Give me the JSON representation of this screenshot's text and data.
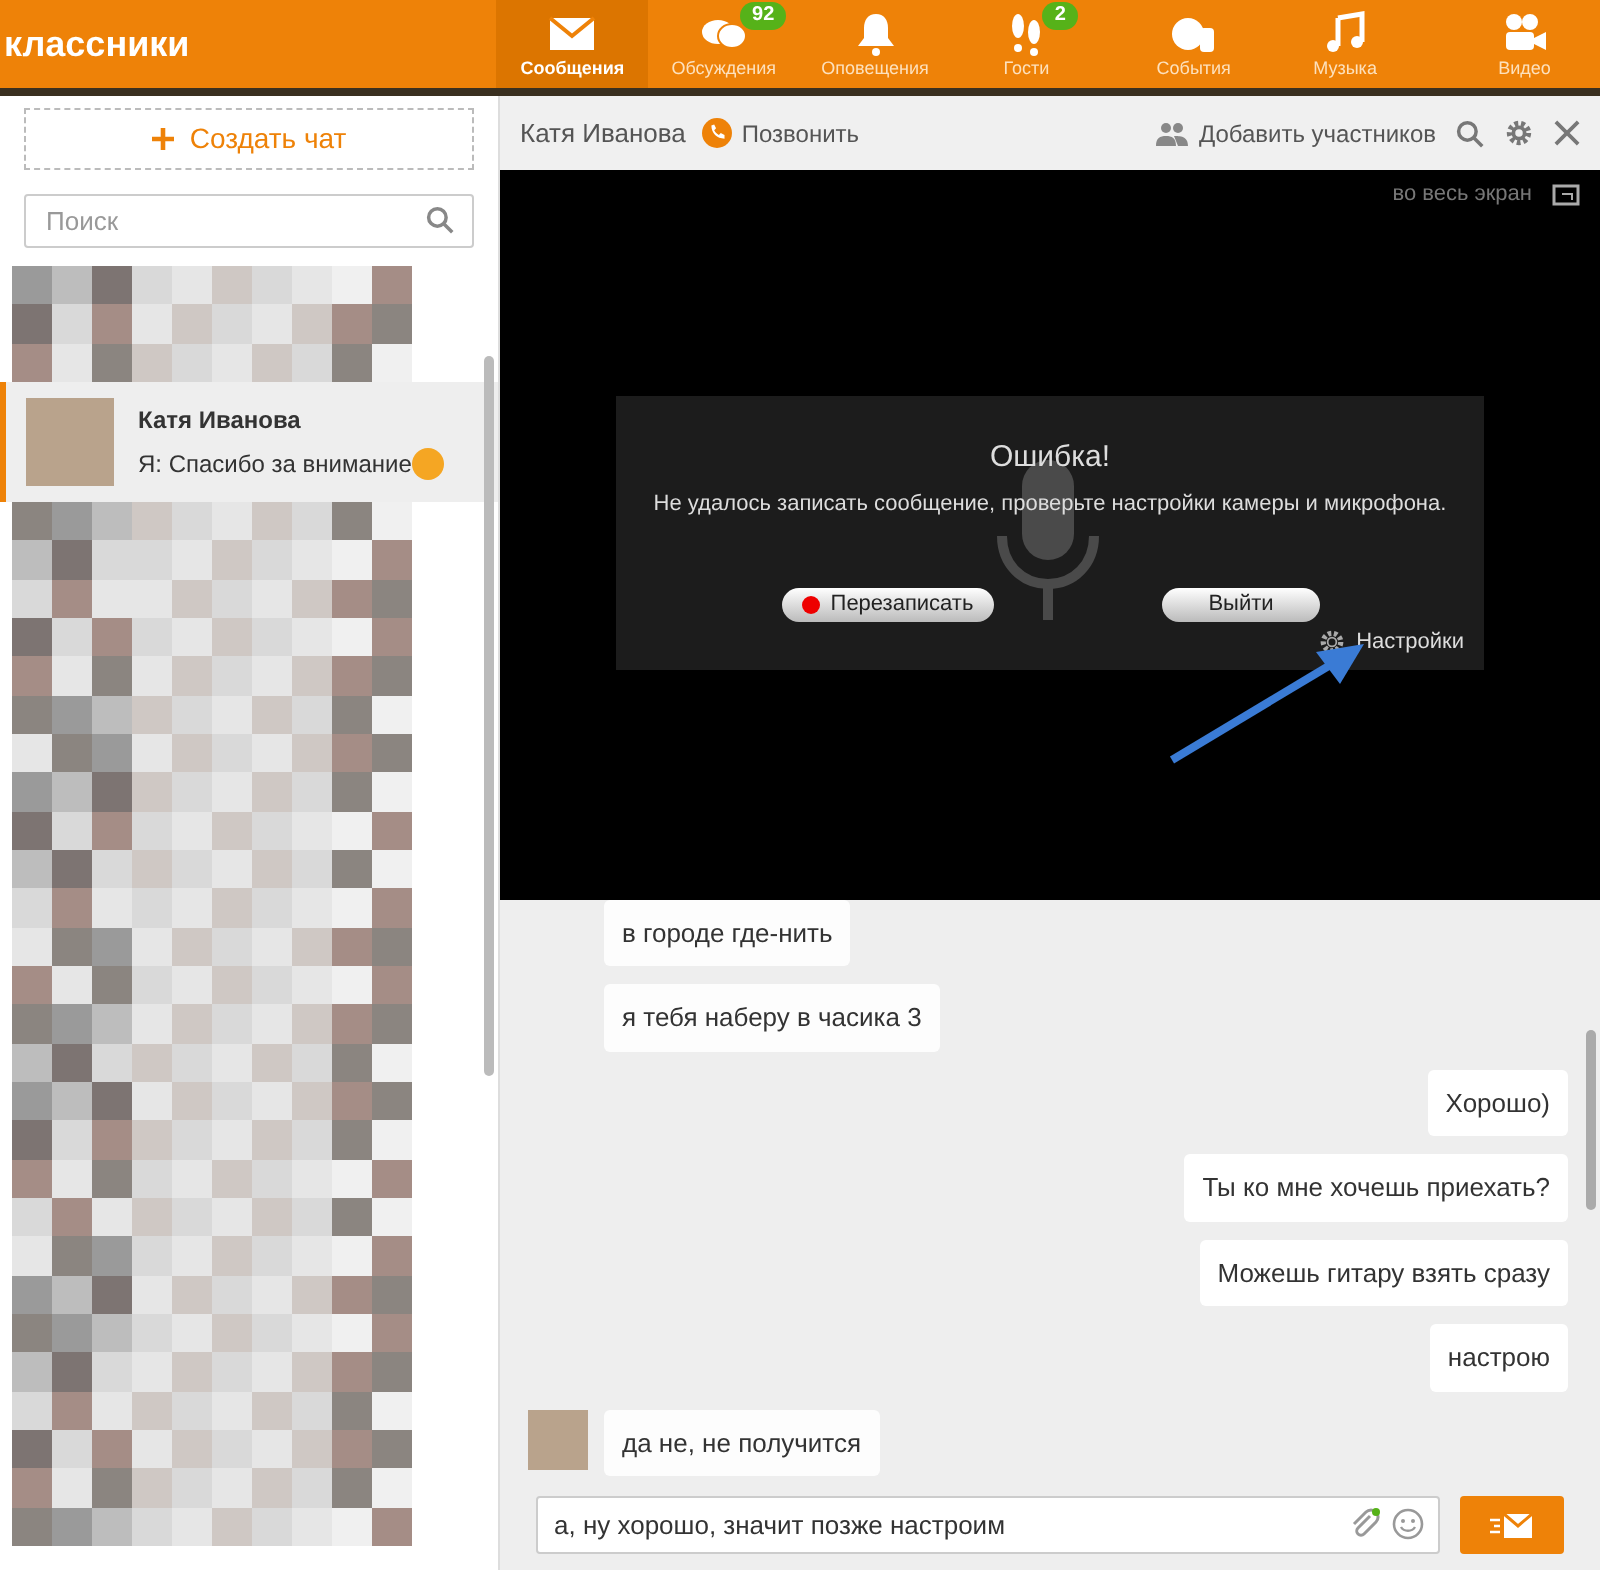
{
  "logo": {
    "text": "классники"
  },
  "nav": [
    {
      "kind": "mail",
      "label": "Сообщения",
      "selected": true
    },
    {
      "kind": "chat",
      "label": "Обсуждения",
      "badge": "92",
      "selected": false
    },
    {
      "kind": "bell",
      "label": "Оповещения",
      "selected": false
    },
    {
      "kind": "steps",
      "label": "Гости",
      "badge": "2",
      "selected": false
    },
    {
      "kind": "events",
      "label": "События",
      "selected": false
    },
    {
      "kind": "music",
      "label": "Музыка",
      "selected": false
    },
    {
      "kind": "video",
      "label": "Видео",
      "selected": false
    }
  ],
  "sidebar": {
    "create_chat": "Создать чат",
    "search": {
      "placeholder": "Поиск"
    },
    "contacts": [
      {
        "kind": "blurred",
        "selected": false
      },
      {
        "kind": "contact",
        "name": "Катя Иванова",
        "preview": "Я: Спасибо за внимание",
        "selected": true
      },
      {
        "kind": "blurred",
        "selected": false
      },
      {
        "kind": "blurred",
        "selected": false
      },
      {
        "kind": "blurred",
        "selected": false
      },
      {
        "kind": "blurred",
        "selected": false
      },
      {
        "kind": "blurred",
        "selected": false
      },
      {
        "kind": "blurred",
        "selected": false
      },
      {
        "kind": "blurred",
        "selected": false
      },
      {
        "kind": "blurred",
        "selected": false
      },
      {
        "kind": "blurred",
        "selected": false
      }
    ]
  },
  "chat": {
    "title": "Катя Иванова",
    "call": "Позвонить",
    "add_members": "Добавить участников"
  },
  "video": {
    "fullscreen": "во весь экран",
    "error_title": "Ошибка!",
    "error_text": "Не удалось записать сообщение, проверьте настройки камеры и микрофона.",
    "rerecord": "Перезаписать",
    "exit": "Выйти",
    "settings": "Настройки"
  },
  "messages": [
    {
      "kind": "incoming",
      "text": "в городе где-нить",
      "avatar": false
    },
    {
      "kind": "incoming",
      "text": "я тебя наберу в часика 3",
      "avatar": false
    },
    {
      "kind": "outgoing",
      "text": "Хорошо)"
    },
    {
      "kind": "outgoing",
      "text": "Ты ко мне хочешь приехать?"
    },
    {
      "kind": "outgoing",
      "text": "Можешь гитару взять сразу"
    },
    {
      "kind": "outgoing",
      "text": "настрою"
    },
    {
      "kind": "incoming",
      "text": "да не, не получится",
      "avatar": true
    }
  ],
  "composer": {
    "value": "а, ну хорошо, значит позже настроим"
  }
}
